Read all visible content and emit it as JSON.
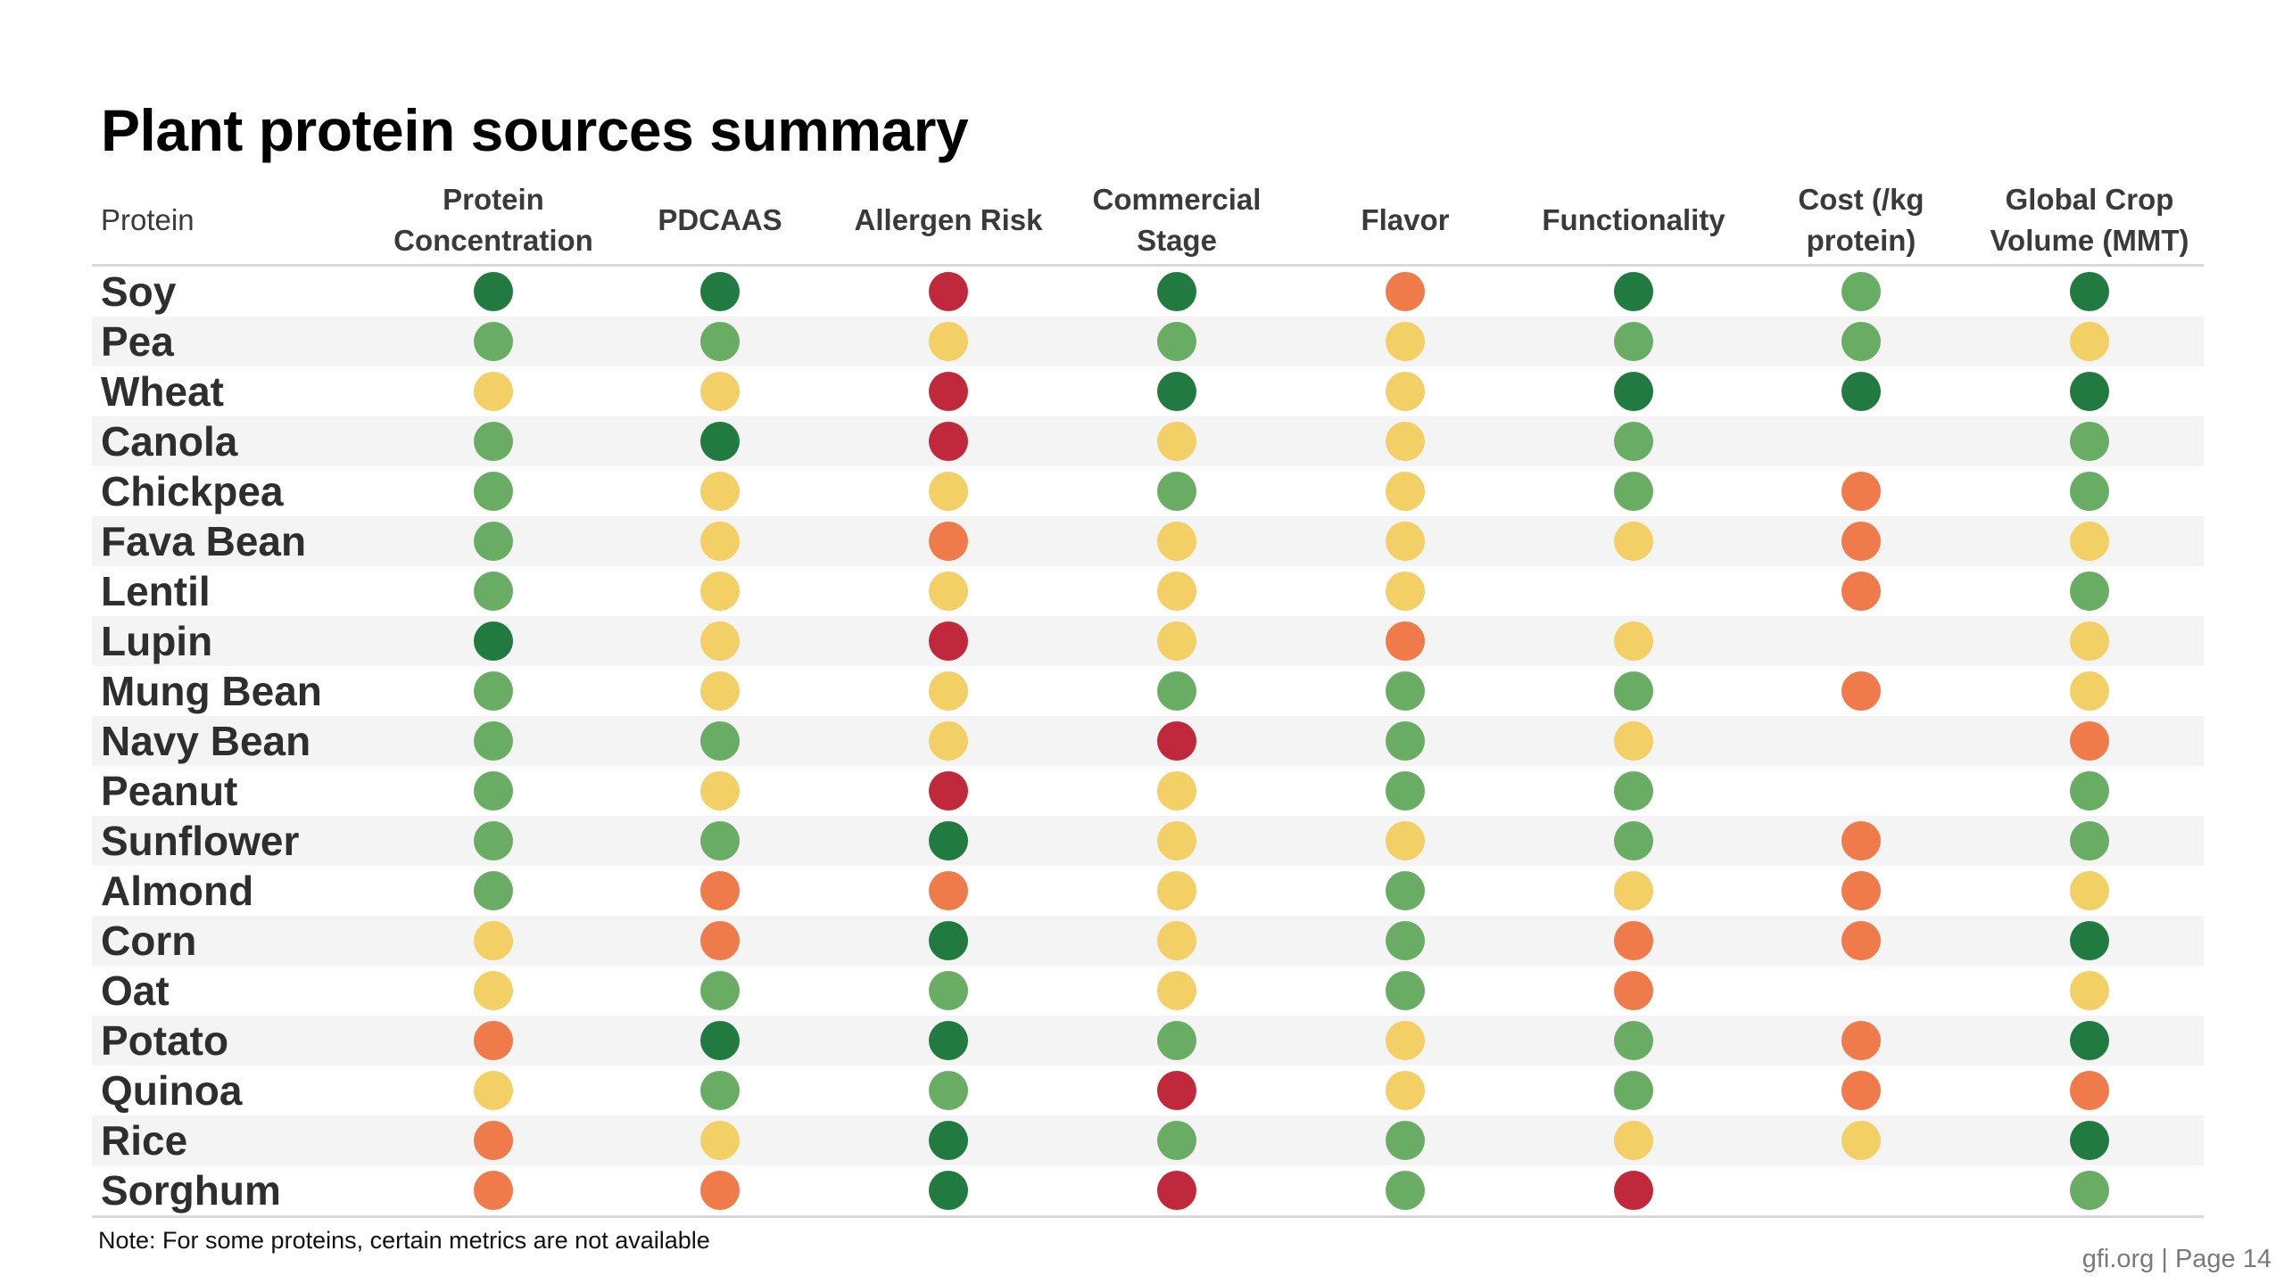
{
  "title": "Plant protein sources summary",
  "note": "Note: For some proteins, certain metrics are not available",
  "footer": "gfi.org | Page 14",
  "colors": {
    "dark_green": "#217a40",
    "light_green": "#69ad65",
    "yellow": "#f2d066",
    "orange": "#ef7a4a",
    "red": "#c0283c"
  },
  "chart_data": {
    "type": "table",
    "title": "Plant protein sources summary",
    "rating_scale": [
      "dark_green",
      "light_green",
      "yellow",
      "orange",
      "red"
    ],
    "row_header": "Protein",
    "columns": [
      "Protein Concentration",
      "PDCAAS",
      "Allergen Risk",
      "Commercial Stage",
      "Flavor",
      "Functionality",
      "Cost (/kg protein)",
      "Global Crop Volume (MMT)"
    ],
    "rows": [
      {
        "name": "Soy",
        "values": [
          "dark_green",
          "dark_green",
          "red",
          "dark_green",
          "orange",
          "dark_green",
          "light_green",
          "dark_green"
        ]
      },
      {
        "name": "Pea",
        "values": [
          "light_green",
          "light_green",
          "yellow",
          "light_green",
          "yellow",
          "light_green",
          "light_green",
          "yellow"
        ]
      },
      {
        "name": "Wheat",
        "values": [
          "yellow",
          "yellow",
          "red",
          "dark_green",
          "yellow",
          "dark_green",
          "dark_green",
          "dark_green"
        ]
      },
      {
        "name": "Canola",
        "values": [
          "light_green",
          "dark_green",
          "red",
          "yellow",
          "yellow",
          "light_green",
          null,
          "light_green"
        ]
      },
      {
        "name": "Chickpea",
        "values": [
          "light_green",
          "yellow",
          "yellow",
          "light_green",
          "yellow",
          "light_green",
          "orange",
          "light_green"
        ]
      },
      {
        "name": "Fava Bean",
        "values": [
          "light_green",
          "yellow",
          "orange",
          "yellow",
          "yellow",
          "yellow",
          "orange",
          "yellow"
        ]
      },
      {
        "name": "Lentil",
        "values": [
          "light_green",
          "yellow",
          "yellow",
          "yellow",
          "yellow",
          null,
          "orange",
          "light_green"
        ]
      },
      {
        "name": "Lupin",
        "values": [
          "dark_green",
          "yellow",
          "red",
          "yellow",
          "orange",
          "yellow",
          null,
          "yellow"
        ]
      },
      {
        "name": "Mung Bean",
        "values": [
          "light_green",
          "yellow",
          "yellow",
          "light_green",
          "light_green",
          "light_green",
          "orange",
          "yellow"
        ]
      },
      {
        "name": "Navy Bean",
        "values": [
          "light_green",
          "light_green",
          "yellow",
          "red",
          "light_green",
          "yellow",
          null,
          "orange"
        ]
      },
      {
        "name": "Peanut",
        "values": [
          "light_green",
          "yellow",
          "red",
          "yellow",
          "light_green",
          "light_green",
          null,
          "light_green"
        ]
      },
      {
        "name": "Sunflower",
        "values": [
          "light_green",
          "light_green",
          "dark_green",
          "yellow",
          "yellow",
          "light_green",
          "orange",
          "light_green"
        ]
      },
      {
        "name": "Almond",
        "values": [
          "light_green",
          "orange",
          "orange",
          "yellow",
          "light_green",
          "yellow",
          "orange",
          "yellow"
        ]
      },
      {
        "name": "Corn",
        "values": [
          "yellow",
          "orange",
          "dark_green",
          "yellow",
          "light_green",
          "orange",
          "orange",
          "dark_green"
        ]
      },
      {
        "name": "Oat",
        "values": [
          "yellow",
          "light_green",
          "light_green",
          "yellow",
          "light_green",
          "orange",
          null,
          "yellow"
        ]
      },
      {
        "name": "Potato",
        "values": [
          "orange",
          "dark_green",
          "dark_green",
          "light_green",
          "yellow",
          "light_green",
          "orange",
          "dark_green"
        ]
      },
      {
        "name": "Quinoa",
        "values": [
          "yellow",
          "light_green",
          "light_green",
          "red",
          "yellow",
          "light_green",
          "orange",
          "orange"
        ]
      },
      {
        "name": "Rice",
        "values": [
          "orange",
          "yellow",
          "dark_green",
          "light_green",
          "light_green",
          "yellow",
          "yellow",
          "dark_green"
        ]
      },
      {
        "name": "Sorghum",
        "values": [
          "orange",
          "orange",
          "dark_green",
          "red",
          "light_green",
          "red",
          null,
          "light_green"
        ]
      }
    ]
  }
}
